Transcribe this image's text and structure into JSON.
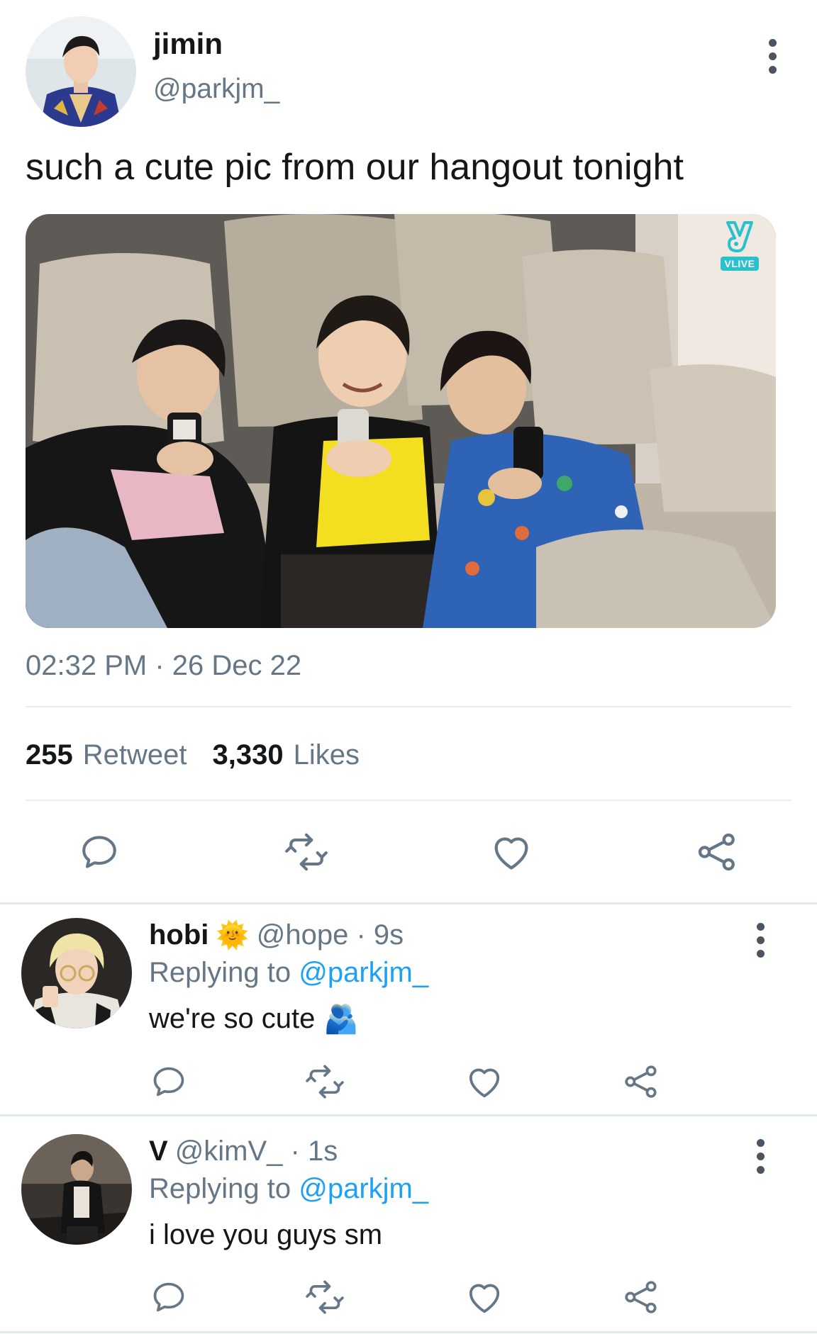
{
  "tweet": {
    "author_name": "jimin",
    "author_handle": "@parkjm_",
    "text": "such a cute pic from our hangout tonight",
    "photo_badge": "VLIVE",
    "timestamp": "02:32 PM · 26 Dec 22",
    "retweet_count": "255",
    "retweet_label": "Retweet",
    "like_count": "3,330",
    "like_label": "Likes"
  },
  "replies": [
    {
      "name": "hobi",
      "emoji": "🌞",
      "handle_time": "@hope · 9s",
      "replying_prefix": "Replying to",
      "replying_to": "@parkjm_",
      "text": "we're so cute",
      "text_emoji": "🫂"
    },
    {
      "name": "V",
      "emoji": "",
      "handle_time": "@kimV_ · 1s",
      "replying_prefix": "Replying to",
      "replying_to": "@parkjm_",
      "text": "i love you guys sm",
      "text_emoji": ""
    }
  ],
  "icons": {
    "reply": "speech-bubble-icon",
    "retweet": "retweet-icon",
    "like": "heart-icon",
    "share": "share-icon",
    "more": "vertical-dots-icon"
  },
  "colors": {
    "link": "#1da1f2",
    "secondary_text": "#657786",
    "icon": "#657786",
    "divider": "#e6ecf0"
  }
}
